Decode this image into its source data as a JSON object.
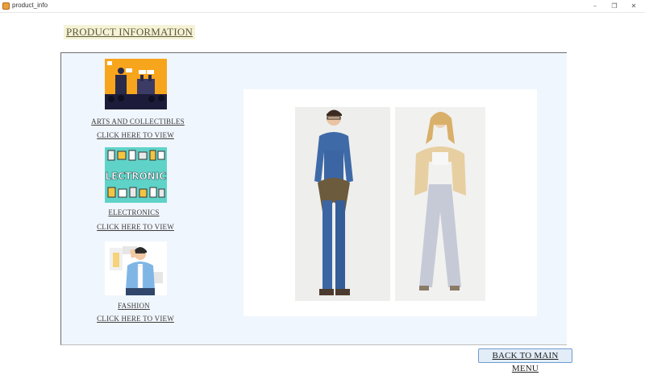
{
  "window": {
    "title": "product_info",
    "minimize_glyph": "–",
    "maximize_glyph": "❐",
    "close_glyph": "✕"
  },
  "page": {
    "title": "PRODUCT INFORMATION"
  },
  "categories": [
    {
      "label": "ARTS AND COLLECTIBLES",
      "link": "CLICK HERE TO VIEW",
      "icon": "auction-illustration-icon"
    },
    {
      "label": "ELECTRONICS",
      "link": "CLICK HERE TO VIEW",
      "icon": "electronics-banner-icon",
      "banner_text": "ELECTRONICS"
    },
    {
      "label": "FASHION",
      "link": "CLICK HERE TO VIEW",
      "icon": "fashion-person-icon"
    }
  ],
  "product_image": {
    "description_icon": "fashion-sketch-image"
  },
  "back_button": {
    "label": "BACK TO MAIN MENU"
  },
  "colors": {
    "panel_bg": "#f0f6fd",
    "title_bg": "#f6f2d6",
    "button_bg": "#e3edf7",
    "button_border": "#6f9bd0",
    "electronics_teal": "#5fd3c8",
    "arts_orange": "#f7a51c"
  }
}
